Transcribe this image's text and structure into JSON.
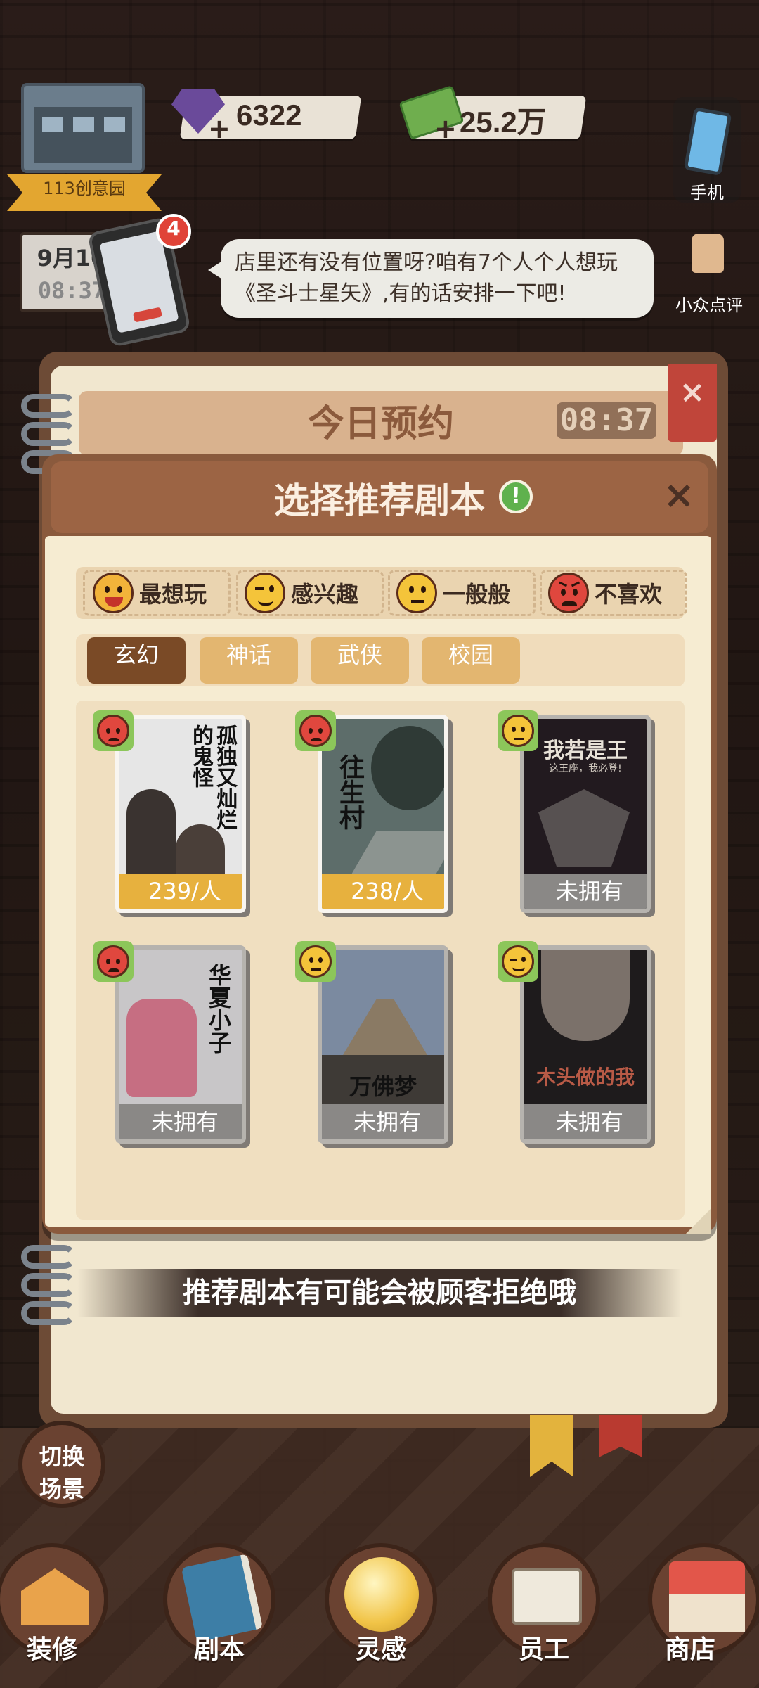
{
  "hud": {
    "location": "113创意园",
    "gems": "6322",
    "money": "25.2万",
    "date": "9月10",
    "time_small": "08:37",
    "phone_badge": "4",
    "phone_label": "手机",
    "review_label": "小众点评"
  },
  "speech": {
    "line1": "店里还有没有位置呀?咱有7个人个人想玩",
    "line2": "《圣斗士星矢》,有的话安排一下吧!"
  },
  "notebook": {
    "title": "今日预约",
    "time": "08:37",
    "close": "×"
  },
  "modal": {
    "title": "选择推荐剧本",
    "info_icon": "!",
    "close": "×",
    "legend": [
      {
        "label": "最想玩",
        "mood": "excited",
        "color": "#f2b33a"
      },
      {
        "label": "感兴趣",
        "mood": "interested",
        "color": "#f4c43a"
      },
      {
        "label": "一般般",
        "mood": "neutral",
        "color": "#f4c43a"
      },
      {
        "label": "不喜欢",
        "mood": "dislike",
        "color": "#e0473e"
      }
    ],
    "tabs": [
      {
        "label": "玄幻",
        "active": true
      },
      {
        "label": "神话",
        "active": false
      },
      {
        "label": "武侠",
        "active": false
      },
      {
        "label": "校园",
        "active": false
      }
    ],
    "scripts": [
      {
        "title": "孤独又灿烂的鬼怪",
        "tag": "239/人",
        "owned": true,
        "mood": "dislike"
      },
      {
        "title": "往生村",
        "tag": "238/人",
        "owned": true,
        "mood": "dislike"
      },
      {
        "title": "我若是王",
        "subtitle": "这王座，我必登!",
        "tag": "未拥有",
        "owned": false,
        "mood": "neutral"
      },
      {
        "title": "华夏小子",
        "tag": "未拥有",
        "owned": false,
        "mood": "dislike"
      },
      {
        "title": "万佛梦",
        "tag": "未拥有",
        "owned": false,
        "mood": "neutral"
      },
      {
        "title": "木头做的我",
        "tag": "未拥有",
        "owned": false,
        "mood": "interested"
      }
    ],
    "hint": "推荐剧本有可能会被顾客拒绝哦"
  },
  "left_button": {
    "label_line1": "切换",
    "label_line2": "场景"
  },
  "nav": [
    {
      "label": "装修",
      "icon": "house-icon"
    },
    {
      "label": "剧本",
      "icon": "book-icon"
    },
    {
      "label": "灵感",
      "icon": "lightbulb-icon"
    },
    {
      "label": "员工",
      "icon": "badge-icon"
    },
    {
      "label": "商店",
      "icon": "shop-icon"
    }
  ],
  "colors": {
    "modal_frame": "#8a5a3d",
    "tab_active": "#7a4a26",
    "tab_inactive": "#e3b670",
    "price_tag": "#e7b13e",
    "locked_tag": "#8a8886",
    "badge_green": "#8cc65a"
  }
}
